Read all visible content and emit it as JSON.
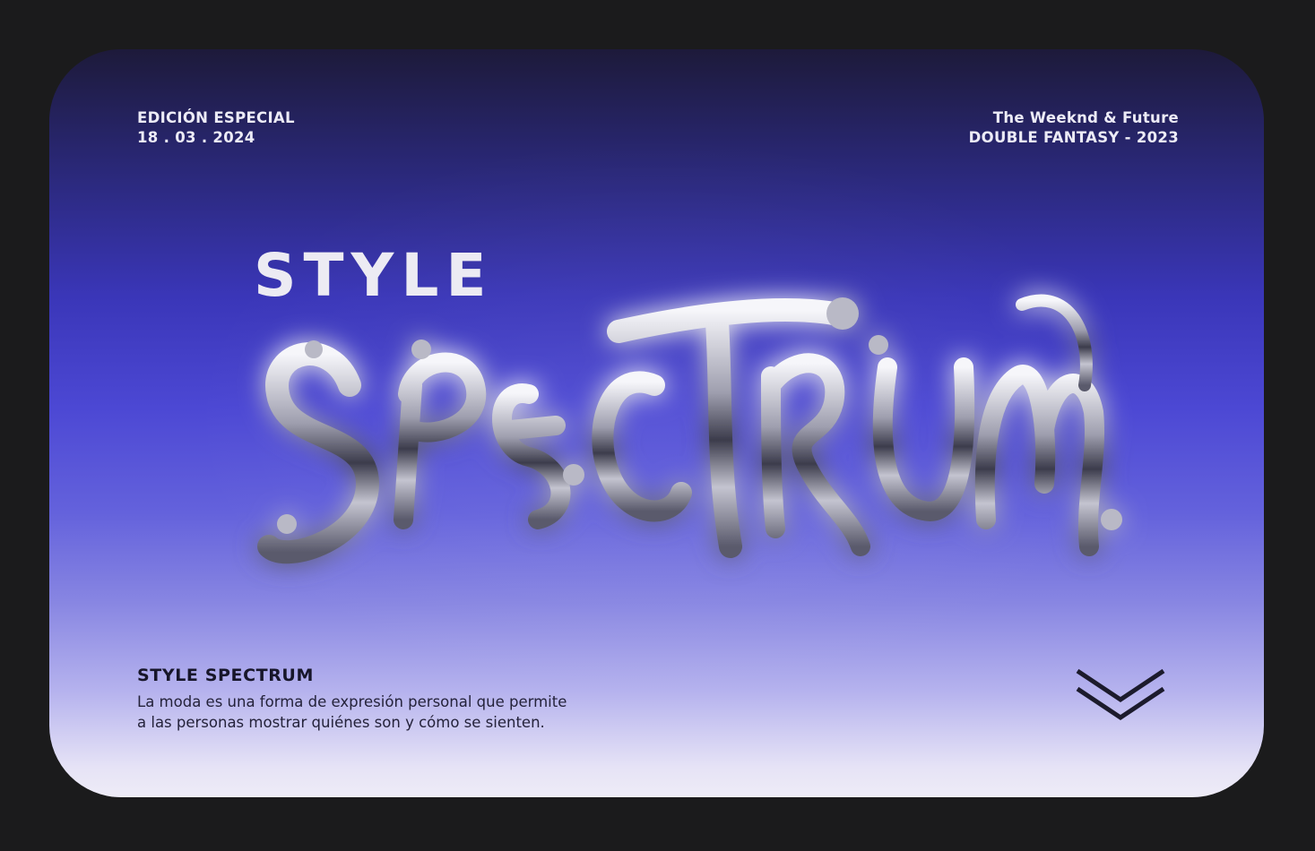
{
  "header": {
    "left_line1": "EDICIÓN ESPECIAL",
    "left_line2": "18 . 03 . 2024",
    "right_line1": "The Weeknd & Future",
    "right_line2": "DOUBLE FANTASY - 2023"
  },
  "hero": {
    "style_word": "STYLE",
    "chrome_word": "SPECTRUM"
  },
  "footer": {
    "title": "STYLE SPECTRUM",
    "desc_line1": "La moda es una forma de expresión personal que permite",
    "desc_line2": "a las personas mostrar quiénes son y cómo se sienten."
  },
  "icons": {
    "scroll": "double-chevron-down-icon"
  },
  "colors": {
    "page_bg": "#1b1b1c",
    "card_top": "#1d1a3a",
    "card_mid": "#4c48d4",
    "card_bottom": "#eeecf7",
    "chrome": "#c9c9d2",
    "header_text": "#ecebf6",
    "footer_text": "#17162a"
  }
}
